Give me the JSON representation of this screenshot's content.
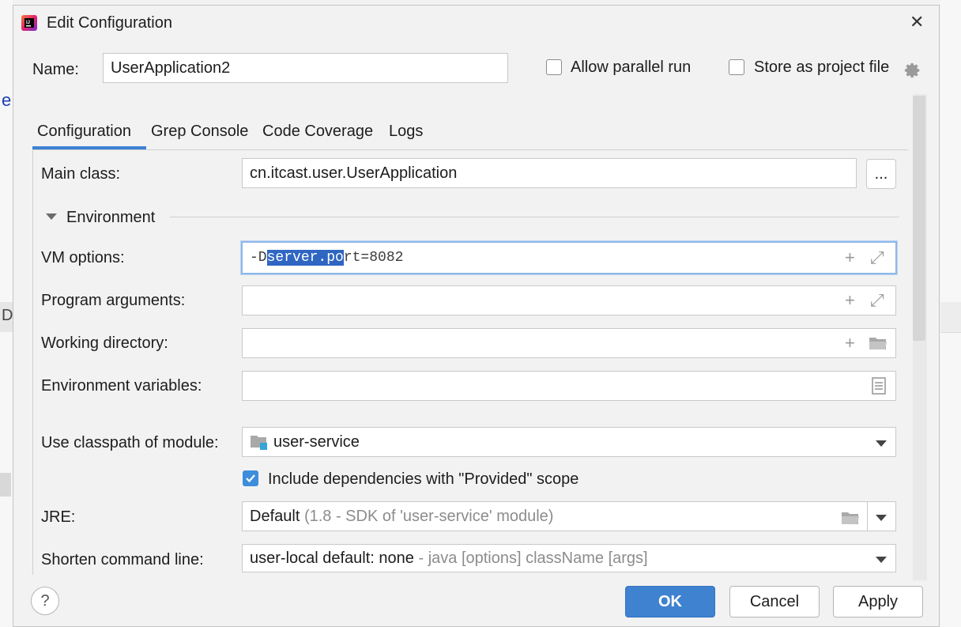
{
  "dialog": {
    "title": "Edit Configuration",
    "close_glyph": "✕"
  },
  "header": {
    "name_label": "Name:",
    "name_value": "UserApplication2",
    "allow_parallel_label": "Allow parallel run",
    "allow_parallel_checked": false,
    "store_project_label": "Store as project file",
    "store_project_checked": false
  },
  "tabs": [
    {
      "label": "Configuration",
      "active": true
    },
    {
      "label": "Grep Console",
      "active": false
    },
    {
      "label": "Code Coverage",
      "active": false
    },
    {
      "label": "Logs",
      "active": false
    }
  ],
  "config": {
    "main_class_label": "Main class:",
    "main_class_value": "cn.itcast.user.UserApplication",
    "browse_label": "...",
    "environment_label": "Environment",
    "vm_options_label": "VM options:",
    "vm_options_prefix": "-D",
    "vm_options_selected": "server.po",
    "vm_options_suffix": "rt=8082",
    "program_args_label": "Program arguments:",
    "working_dir_label": "Working directory:",
    "env_vars_label": "Environment variables:",
    "classpath_label": "Use classpath of module:",
    "classpath_value": "user-service",
    "include_deps_label": "Include dependencies with \"Provided\" scope",
    "include_deps_checked": true,
    "jre_label": "JRE:",
    "jre_value": "Default",
    "jre_hint": "(1.8 - SDK of 'user-service' module)",
    "shorten_label": "Shorten command line:",
    "shorten_value": "user-local default: none",
    "shorten_hint": "- java [options] className [args]"
  },
  "footer": {
    "help_label": "?",
    "ok_label": "OK",
    "cancel_label": "Cancel",
    "apply_label": "Apply"
  },
  "background": {
    "left_char_1": "e",
    "left_char_2": "D"
  },
  "icons": {
    "add": "+",
    "expand": "⤢"
  },
  "colors": {
    "accent": "#3d82d4",
    "selection": "#2e66c2",
    "checkbox_on": "#3d8ddb"
  }
}
